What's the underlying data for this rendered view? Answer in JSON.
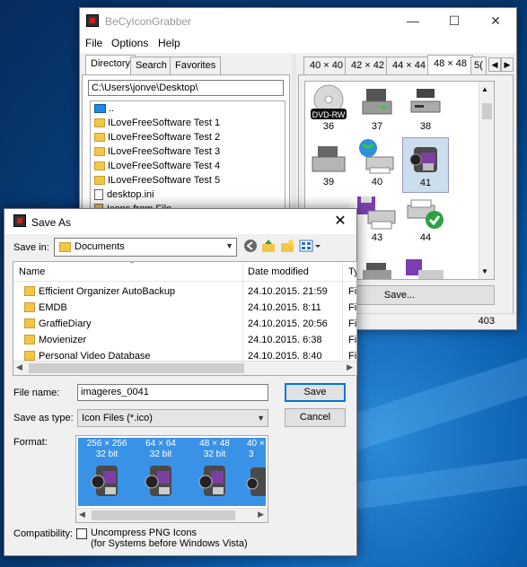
{
  "main_window": {
    "title": "BeCyIconGrabber",
    "menu": [
      "File",
      "Options",
      "Help"
    ],
    "left_tabs": [
      "Directory",
      "Search",
      "Favorites"
    ],
    "path": "C:\\Users\\jonve\\Desktop\\",
    "tree": [
      {
        "name": "..",
        "icon": "desktop-icon"
      },
      {
        "name": "ILoveFreeSoftware Test 1",
        "icon": "folder-icon"
      },
      {
        "name": "ILoveFreeSoftware Test 2",
        "icon": "folder-icon"
      },
      {
        "name": "ILoveFreeSoftware Test 3",
        "icon": "folder-icon"
      },
      {
        "name": "ILoveFreeSoftware Test 4",
        "icon": "folder-icon"
      },
      {
        "name": "ILoveFreeSoftware Test 5",
        "icon": "folder-icon"
      },
      {
        "name": "desktop.ini",
        "icon": "ini-file-icon"
      },
      {
        "name": "Icons from File",
        "icon": "shortcut-icon"
      }
    ],
    "size_tabs": [
      "40 × 40",
      "42 × 42",
      "44 × 44",
      "48 × 48",
      "5("
    ],
    "icons": [
      {
        "label": "36",
        "kind": "dvd-rw"
      },
      {
        "label": "37",
        "kind": "drive"
      },
      {
        "label": "38",
        "kind": "drive-slim"
      },
      {
        "label": "39",
        "kind": "drive-grey"
      },
      {
        "label": "40",
        "kind": "network-printer"
      },
      {
        "label": "41",
        "kind": "camcorder"
      },
      {
        "label": "",
        "kind": "hidden"
      },
      {
        "label": "43",
        "kind": "printer-floppy"
      },
      {
        "label": "44",
        "kind": "printer-check"
      },
      {
        "label": "",
        "kind": "drive-partial"
      },
      {
        "label": "",
        "kind": "printer-partial"
      }
    ],
    "dvd_label": "DVD-RW",
    "save_button": "Save...",
    "status_count": "403"
  },
  "dialog": {
    "title": "Save As",
    "save_in_label": "Save in:",
    "save_in_value": "Documents",
    "columns": {
      "name": "Name",
      "date": "Date modified",
      "type": "Ty"
    },
    "files": [
      {
        "name": "Efficient Organizer AutoBackup",
        "date": "24.10.2015. 21:59",
        "type": "Fi"
      },
      {
        "name": "EMDB",
        "date": "24.10.2015. 8:11",
        "type": "Fi"
      },
      {
        "name": "GraffieDiary",
        "date": "24.10.2015. 20:56",
        "type": "Fi"
      },
      {
        "name": "Movienizer",
        "date": "24.10.2015. 6:38",
        "type": "Fi"
      },
      {
        "name": "Personal Video Database",
        "date": "24.10.2015. 8:40",
        "type": "Fi"
      }
    ],
    "file_name_label": "File name:",
    "file_name_value": "imageres_0041",
    "save_type_label": "Save as type:",
    "save_type_value": "Icon Files (*.ico)",
    "save_button": "Save",
    "cancel_button": "Cancel",
    "format_label": "Format:",
    "formats": [
      {
        "size": "256 × 256",
        "bits": "32 bit"
      },
      {
        "size": "64 × 64",
        "bits": "32 bit"
      },
      {
        "size": "48 × 48",
        "bits": "32 bit"
      },
      {
        "size": "40 ×",
        "bits": "3"
      }
    ],
    "compat_label": "Compatibility:",
    "compat_line1": "Uncompress PNG Icons",
    "compat_line2": "(for Systems before Windows Vista)"
  }
}
